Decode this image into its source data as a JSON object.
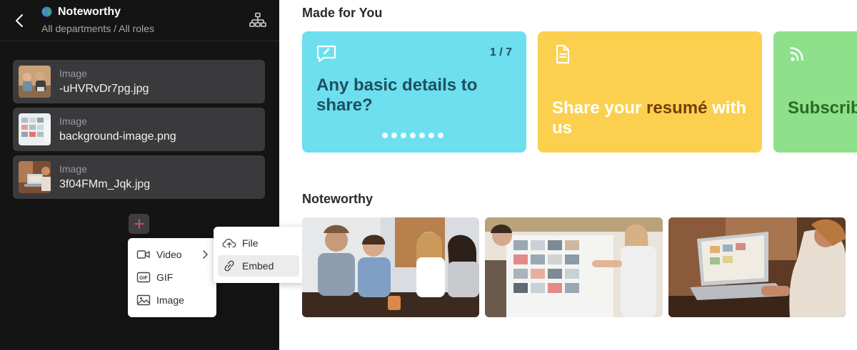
{
  "header": {
    "title": "Noteworthy",
    "subtitle": "All departments / All roles",
    "icons": [
      "chevron-left-icon",
      "globe-icon",
      "sitemap-icon"
    ]
  },
  "files": [
    {
      "type": "Image",
      "name": "-uHVRvDr7pg.jpg"
    },
    {
      "type": "Image",
      "name": "background-image.png"
    },
    {
      "type": "Image",
      "name": "3f04FMm_Jqk.jpg"
    }
  ],
  "add_menu": {
    "items": [
      {
        "label": "Video",
        "icon": "video-icon",
        "has_submenu": true
      },
      {
        "label": "GIF",
        "icon": "gif-icon"
      },
      {
        "label": "Image",
        "icon": "image-icon"
      }
    ]
  },
  "video_submenu": {
    "items": [
      {
        "label": "File",
        "icon": "cloud-upload-icon"
      },
      {
        "label": "Embed",
        "icon": "link-icon"
      }
    ]
  },
  "made_for_you": {
    "title": "Made for You",
    "cards": [
      {
        "text": "Any basic details to share?",
        "counter": "1 / 7",
        "icon": "edit-chat-icon",
        "color": "#6ddfef"
      },
      {
        "text_before": "Share your ",
        "highlight": "resumé",
        "text_after": " with us",
        "icon": "document-icon",
        "color": "#fbd04e"
      },
      {
        "text": "Subscribe to updates",
        "icon": "rss-icon",
        "color": "#8ee08a"
      }
    ]
  },
  "noteworthy": {
    "title": "Noteworthy"
  },
  "colors": {
    "panel_bg": "#141414",
    "file_item_bg": "#3a3a3c",
    "add_plus": "#e0457b",
    "highlight_text": "#7a3d0a"
  }
}
